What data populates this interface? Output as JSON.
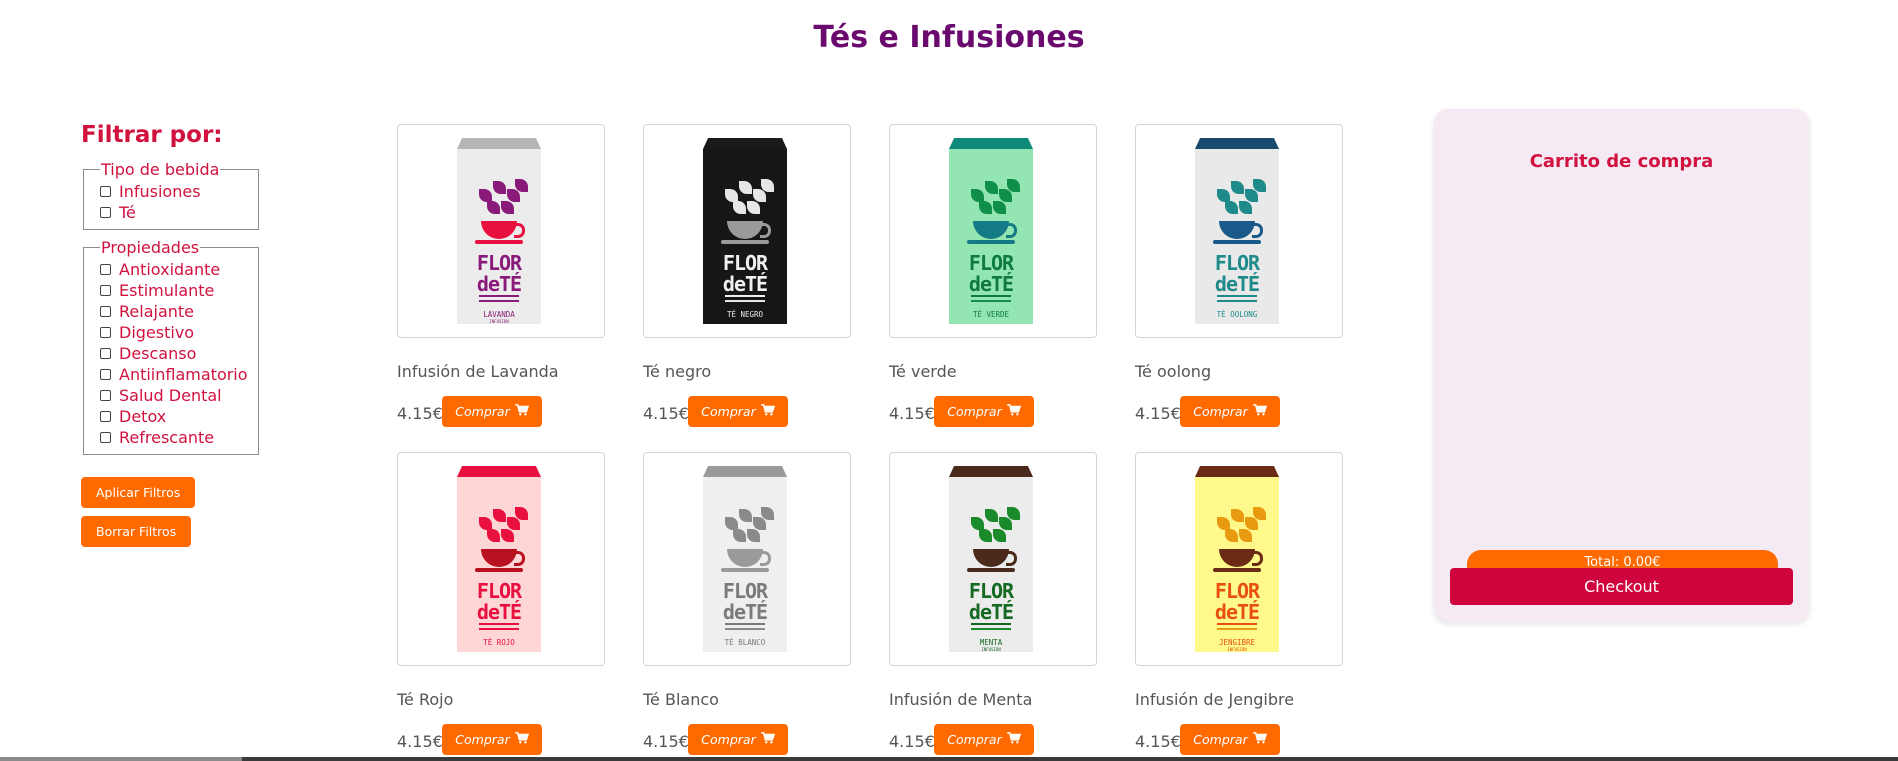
{
  "page": {
    "title": "Tés e Infusiones"
  },
  "filters": {
    "heading": "Filtrar por:",
    "groups": [
      {
        "legend": "Tipo de bebida",
        "options": [
          "Infusiones",
          "Té"
        ]
      },
      {
        "legend": "Propiedades",
        "options": [
          "Antioxidante",
          "Estimulante",
          "Relajante",
          "Digestivo",
          "Descanso",
          "Antiinflamatorio",
          "Salud Dental",
          "Detox",
          "Refrescante"
        ]
      }
    ],
    "apply_label": "Aplicar Filtros",
    "clear_label": "Borrar Filtros"
  },
  "products": [
    {
      "name": "Infusión de Lavanda",
      "price": "4.15€",
      "buy_label": "Comprar",
      "pkg_label": "LAVANDA",
      "pkg_sub": "INFUSIÓN",
      "colors": {
        "cap": "#b5b5b5",
        "body": "#ececec",
        "accent": "#8a1a7a",
        "cup": "#e8103e",
        "text": "#8a1a7a"
      }
    },
    {
      "name": "Té negro",
      "price": "4.15€",
      "buy_label": "Comprar",
      "pkg_label": "TÉ NEGRO",
      "pkg_sub": "",
      "colors": {
        "cap": "#1a1a1a",
        "body": "#161616",
        "accent": "#e6e6e6",
        "cup": "#9a9a9a",
        "text": "#f0f0f0"
      }
    },
    {
      "name": "Té verde",
      "price": "4.15€",
      "buy_label": "Comprar",
      "pkg_label": "TÉ VERDE",
      "pkg_sub": "",
      "colors": {
        "cap": "#0e8a7a",
        "body": "#93e6b2",
        "accent": "#0f8f4a",
        "cup": "#147a86",
        "text": "#0f7a3e"
      }
    },
    {
      "name": "Té oolong",
      "price": "4.15€",
      "buy_label": "Comprar",
      "pkg_label": "TÉ OOLONG",
      "pkg_sub": "",
      "colors": {
        "cap": "#1a4a6e",
        "body": "#e9e9e9",
        "accent": "#1f8a8a",
        "cup": "#1a5a8a",
        "text": "#1f8a8a"
      }
    },
    {
      "name": "Té Rojo",
      "price": "4.15€",
      "buy_label": "Comprar",
      "pkg_label": "TÉ ROJO",
      "pkg_sub": "",
      "colors": {
        "cap": "#e8103e",
        "body": "#ffd6d6",
        "accent": "#e8103e",
        "cup": "#b8101e",
        "text": "#e8103e"
      }
    },
    {
      "name": "Té Blanco",
      "price": "4.15€",
      "buy_label": "Comprar",
      "pkg_label": "TÉ BLANCO",
      "pkg_sub": "",
      "colors": {
        "cap": "#9a9a9a",
        "body": "#efefef",
        "accent": "#8a8a8a",
        "cup": "#9a9a9a",
        "text": "#7a7a7a"
      }
    },
    {
      "name": "Infusión de Menta",
      "price": "4.15€",
      "buy_label": "Comprar",
      "pkg_label": "MENTA",
      "pkg_sub": "INFUSIÓN",
      "colors": {
        "cap": "#4a2a1a",
        "body": "#ececec",
        "accent": "#1a8a2a",
        "cup": "#4a2a1a",
        "text": "#146a22"
      }
    },
    {
      "name": "Infusión de Jengibre",
      "price": "4.15€",
      "buy_label": "Comprar",
      "pkg_label": "JENGIBRE",
      "pkg_sub": "INFUSIÓN",
      "colors": {
        "cap": "#6a2a14",
        "body": "#fff88a",
        "accent": "#e89a10",
        "cup": "#6a2a14",
        "text": "#e85010"
      }
    }
  ],
  "cart": {
    "title": "Carrito de compra",
    "total_label": "Total: 0.00€",
    "checkout_label": "Checkout"
  },
  "icons": {
    "cart": "shopping-cart-icon",
    "checkbox": "checkbox-unchecked"
  },
  "brand_text": [
    "FLOR",
    "deTÉ"
  ]
}
